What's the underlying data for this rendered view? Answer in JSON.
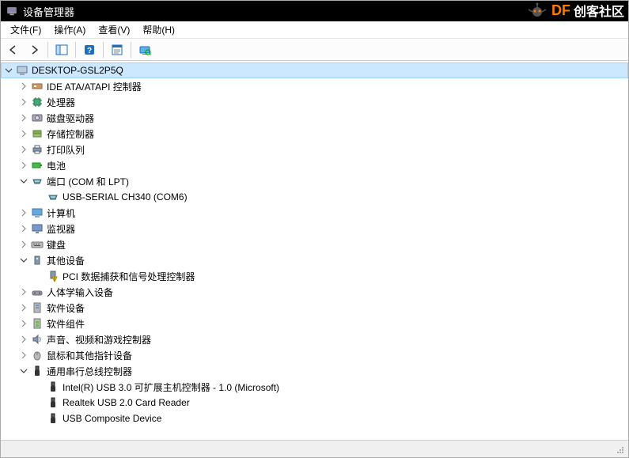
{
  "window": {
    "title": "设备管理器"
  },
  "watermark": {
    "brand": "DF",
    "text": "创客社区"
  },
  "menu": {
    "file": "文件(F)",
    "action": "操作(A)",
    "view": "查看(V)",
    "help": "帮助(H)"
  },
  "tree": {
    "root": "DESKTOP-GSL2P5Q",
    "ide": "IDE ATA/ATAPI 控制器",
    "cpu": "处理器",
    "disk": "磁盘驱动器",
    "storage": "存储控制器",
    "printq": "打印队列",
    "battery": "电池",
    "ports": "端口 (COM 和 LPT)",
    "ports_ch340": "USB-SERIAL CH340 (COM6)",
    "computer": "计算机",
    "monitor": "监视器",
    "keyboard": "键盘",
    "other": "其他设备",
    "other_pci": "PCI 数据捕获和信号处理控制器",
    "hid": "人体学输入设备",
    "swdev": "软件设备",
    "swcomp": "软件组件",
    "sound": "声音、视频和游戏控制器",
    "mouse": "鼠标和其他指针设备",
    "usb": "通用串行总线控制器",
    "usb_intel": "Intel(R) USB 3.0 可扩展主机控制器 - 1.0 (Microsoft)",
    "usb_realtek": "Realtek USB 2.0 Card Reader",
    "usb_composite": "USB Composite Device"
  }
}
